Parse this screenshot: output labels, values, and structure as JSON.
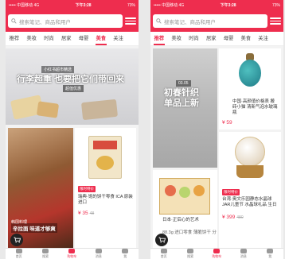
{
  "status_left": {
    "carrier": "•••••  中国移动  4G",
    "time": "下午3:28",
    "battery": "73%"
  },
  "status_right": {
    "carrier": "•••••  中国移动  4G",
    "time": "下午3:28",
    "battery": "73%"
  },
  "search": {
    "placeholder": "搜索笔记、商品和用户"
  },
  "tabs_left": [
    "推荐",
    "美妆",
    "时尚",
    "居家",
    "母婴",
    "美食",
    "关注"
  ],
  "tabs_right": [
    "推荐",
    "美妆",
    "时尚",
    "居家",
    "母婴",
    "美食",
    "关注"
  ],
  "left": {
    "banner": {
      "sub": "小红书超市精选",
      "headline": "行李超重 也要把它们带回来",
      "note": "超值优惠"
    },
    "food_card": {
      "tag": "韩国料理",
      "title": "辛拉面 味道才够爽"
    },
    "product": {
      "badge": "限时特价",
      "title": "瑞典·饱的饼干零食 ICA 原装进口",
      "price": "¥ 35",
      "old_price": "48"
    }
  },
  "right": {
    "feature": {
      "date": "03.05",
      "headline": "初春针织\n单品上新"
    },
    "vase": {
      "title": "中国·高颜值价格表 搬砖小猫 清新气泡水玻璃瓶",
      "price": "¥ 59"
    },
    "snack": {
      "title": "日本·正后心的艺术",
      "meta": "88.3g 进口零食 薄脆饼干 分销"
    },
    "globe": {
      "badge": "限时特价",
      "title": "台湾·奥文乐园静态水晶球 JAR儿童节 水晶球礼品 生日",
      "price": "¥ 399",
      "old_price": "480"
    }
  },
  "nav": [
    {
      "label": "首页"
    },
    {
      "label": "搜索"
    },
    {
      "label": "购物车"
    },
    {
      "label": "消息"
    },
    {
      "label": "我"
    }
  ],
  "colors": {
    "brand": "#ee2d4e"
  }
}
